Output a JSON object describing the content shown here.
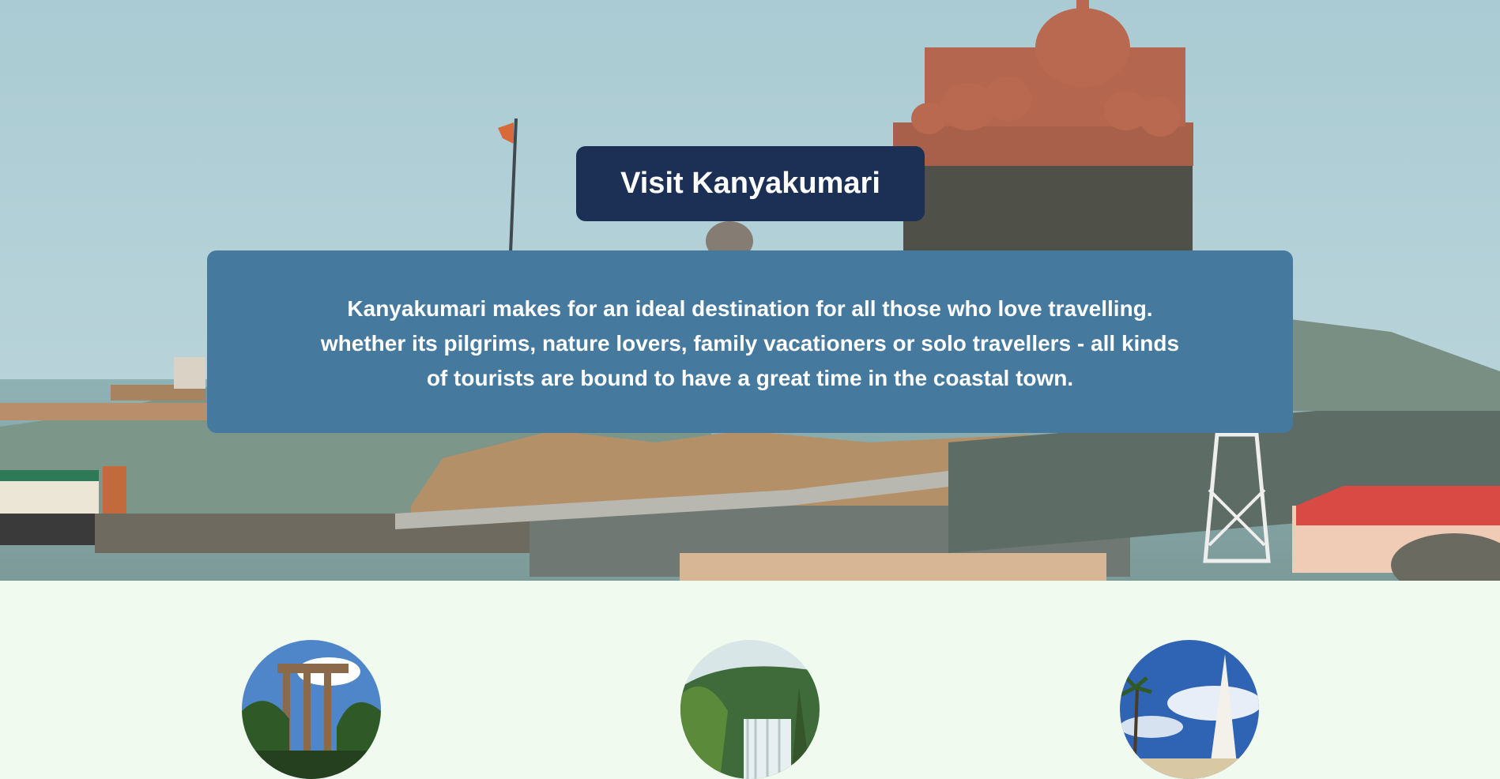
{
  "hero": {
    "title": "Visit Kanyakumari",
    "description_lines": [
      "Kanyakumari makes for an ideal destination for all those who love travelling.",
      "whether its pilgrims, nature lovers, family vacationers or solo travellers - all kinds",
      "of tourists are bound to have a great time in the coastal town."
    ]
  },
  "colors": {
    "page_background": "#f0faef",
    "title_box": "#1c3055",
    "description_box": "#45799e",
    "text": "#ffffff"
  },
  "gallery": [
    {
      "icon": "palm-trees-pillars-photo"
    },
    {
      "icon": "waterfall-photo"
    },
    {
      "icon": "beach-sculpture-photo"
    }
  ]
}
